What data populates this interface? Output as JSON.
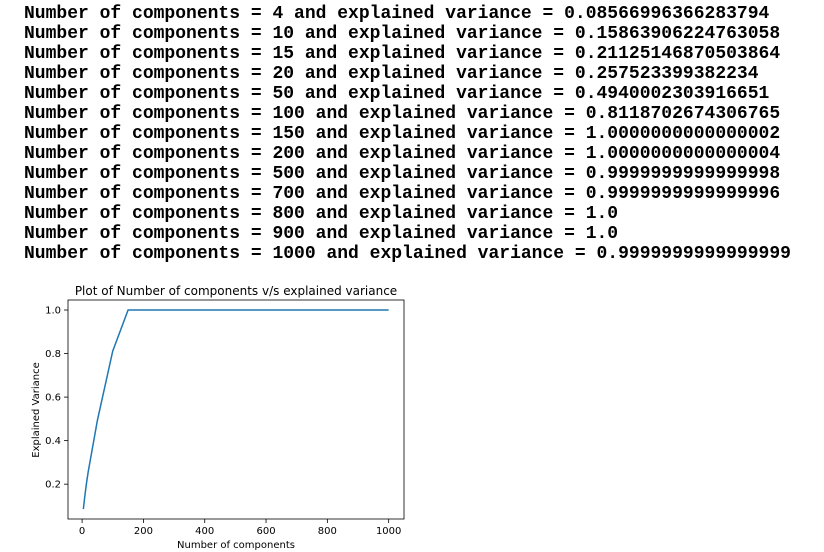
{
  "output_lines": [
    "Number of components = 4 and explained variance = 0.08566996366283794",
    "Number of components = 10 and explained variance = 0.15863906224763058",
    "Number of components = 15 and explained variance = 0.21125146870503864",
    "Number of components = 20 and explained variance = 0.257523399382234",
    "Number of components = 50 and explained variance = 0.4940002303916651",
    "Number of components = 100 and explained variance = 0.8118702674306765",
    "Number of components = 150 and explained variance = 1.0000000000000002",
    "Number of components = 200 and explained variance = 1.0000000000000004",
    "Number of components = 500 and explained variance = 0.9999999999999998",
    "Number of components = 700 and explained variance = 0.9999999999999996",
    "Number of components = 800 and explained variance = 1.0",
    "Number of components = 900 and explained variance = 1.0",
    "Number of components = 1000 and explained variance = 0.9999999999999999"
  ],
  "chart_data": {
    "type": "line",
    "title": "Plot of Number of components v/s explained variance",
    "xlabel": "Number of components",
    "ylabel": "Explained Variance",
    "x": [
      4,
      10,
      15,
      20,
      50,
      100,
      150,
      200,
      500,
      700,
      800,
      900,
      1000
    ],
    "series": [
      {
        "values": [
          0.08566996366283794,
          0.15863906224763058,
          0.21125146870503864,
          0.257523399382234,
          0.4940002303916651,
          0.8118702674306765,
          1.0000000000000002,
          1.0000000000000004,
          0.9999999999999998,
          0.9999999999999996,
          1.0,
          1.0,
          0.9999999999999999
        ],
        "color": "#1f77b4"
      }
    ],
    "xlim": [
      -46,
      1050
    ],
    "ylim": [
      0.04,
      1.046
    ],
    "xticks": [
      0,
      200,
      400,
      600,
      800,
      1000
    ],
    "yticks": [
      0.2,
      0.4,
      0.6,
      0.8,
      1.0
    ],
    "ytick_labels": [
      "0.2",
      "0.4",
      "0.6",
      "0.8",
      "1.0"
    ],
    "grid": false
  }
}
